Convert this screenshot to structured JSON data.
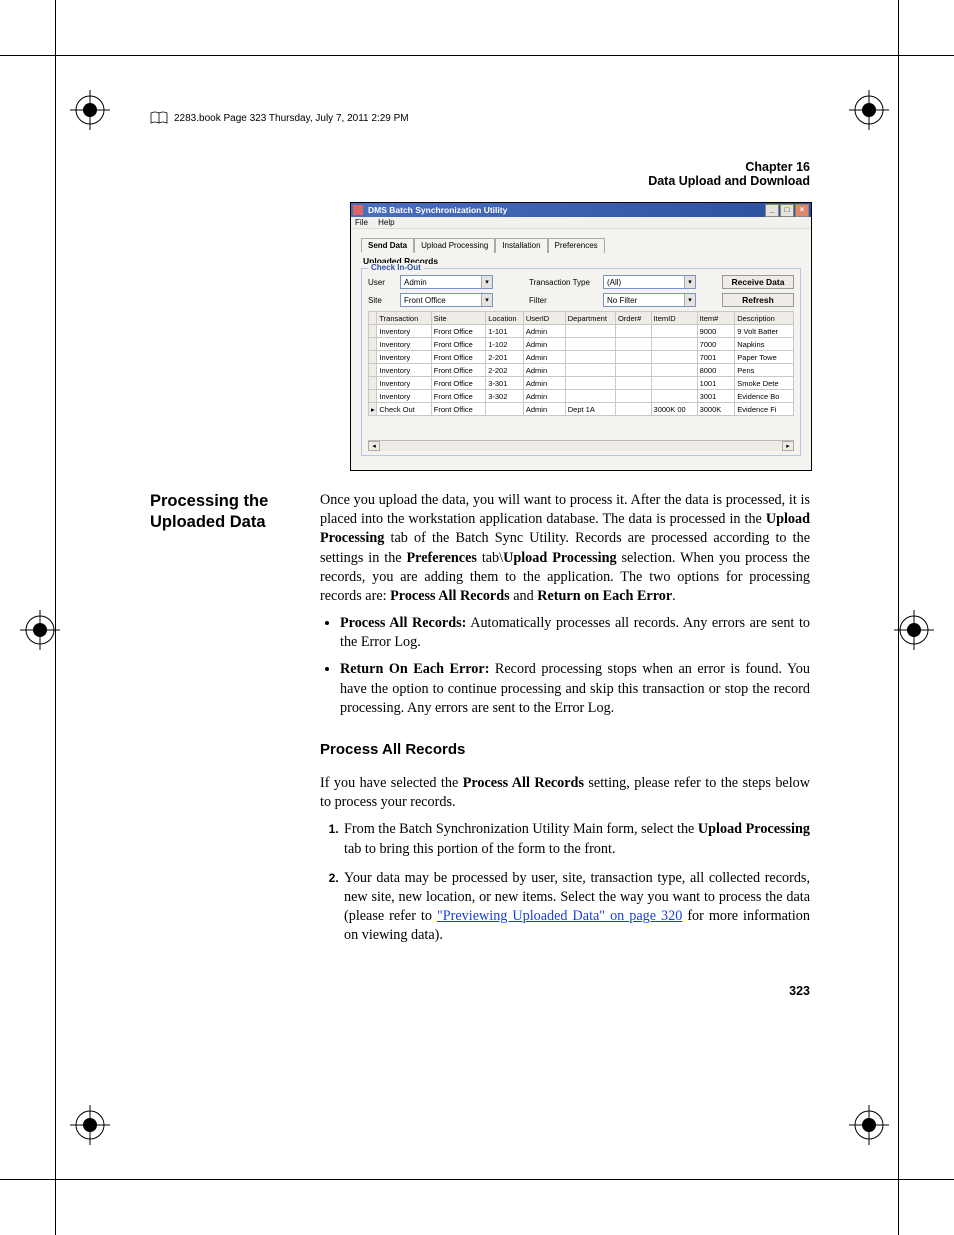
{
  "running_head": "2283.book  Page 323  Thursday, July 7, 2011  2:29 PM",
  "chapter": {
    "line1": "Chapter 16",
    "line2": "Data Upload and Download"
  },
  "page_number": "323",
  "screenshot": {
    "title": "DMS Batch Synchronization Utility",
    "menus": [
      "File",
      "Help"
    ],
    "tabs": [
      "Send Data",
      "Upload Processing",
      "Installation",
      "Preferences"
    ],
    "section_label": "Uploaded Records",
    "group_legend": "Check In-Out",
    "filters": {
      "user_label": "User",
      "user_value": "Admin",
      "site_label": "Site",
      "site_value": "Front Office",
      "txn_label": "Transaction Type",
      "txn_value": "(All)",
      "filter_label": "Filter",
      "filter_value": "No Filter"
    },
    "buttons": {
      "receive": "Receive Data",
      "refresh": "Refresh"
    },
    "columns": [
      "Transaction",
      "Site",
      "Location",
      "UserID",
      "Department",
      "Order#",
      "ItemID",
      "Item#",
      "Description"
    ],
    "rows": [
      {
        "txn": "Inventory",
        "site": "Front Office",
        "loc": "1-101",
        "user": "Admin",
        "dept": "",
        "order": "",
        "itemid": "",
        "itemno": "9000",
        "desc": "9 Volt Batter"
      },
      {
        "txn": "Inventory",
        "site": "Front Office",
        "loc": "1-102",
        "user": "Admin",
        "dept": "",
        "order": "",
        "itemid": "",
        "itemno": "7000",
        "desc": "Napkins"
      },
      {
        "txn": "Inventory",
        "site": "Front Office",
        "loc": "2-201",
        "user": "Admin",
        "dept": "",
        "order": "",
        "itemid": "",
        "itemno": "7001",
        "desc": "Paper Towe"
      },
      {
        "txn": "Inventory",
        "site": "Front Office",
        "loc": "2-202",
        "user": "Admin",
        "dept": "",
        "order": "",
        "itemid": "",
        "itemno": "8000",
        "desc": "Pens"
      },
      {
        "txn": "Inventory",
        "site": "Front Office",
        "loc": "3-301",
        "user": "Admin",
        "dept": "",
        "order": "",
        "itemid": "",
        "itemno": "1001",
        "desc": "Smoke Dete"
      },
      {
        "txn": "Inventory",
        "site": "Front Office",
        "loc": "3-302",
        "user": "Admin",
        "dept": "",
        "order": "",
        "itemid": "",
        "itemno": "3001",
        "desc": "Evidence Bo"
      },
      {
        "txn": "Check Out",
        "site": "Front Office",
        "loc": "",
        "user": "Admin",
        "dept": "Dept 1A",
        "order": "",
        "itemid": "3000K 00",
        "itemno": "3000K",
        "desc": "Evidence Fi"
      }
    ]
  },
  "side_heading": "Processing the Uploaded Data",
  "body": {
    "p1_a": "Once you upload the data, you will want to process it. After the data is processed, it is placed into the workstation application database. The data is processed in the ",
    "p1_b": "Upload Processing",
    "p1_c": " tab of the Batch Sync Utility. Records are processed according to the settings in the ",
    "p1_d": "Preferences",
    "p1_e": " tab\\",
    "p1_f": "Upload Processing",
    "p1_g": " selection. When you process the records, you are adding them to the  application. The two options for processing records are: ",
    "p1_h": "Process All Records",
    "p1_i": " and ",
    "p1_j": "Return on Each Error",
    "p1_k": ".",
    "bullet1_head": "Process All Records:",
    "bullet1_tail": " Automatically processes all records. Any errors are sent to the Error Log.",
    "bullet2_head": "Return On Each Error:",
    "bullet2_tail": " Record processing stops when an error is found. You have the option to continue processing and skip this transaction or stop the record processing. Any errors are sent to the Error Log.",
    "subhead": "Process All Records",
    "p2_a": "If you have selected the ",
    "p2_b": "Process All Records",
    "p2_c": " setting, please refer to the steps below to process your records.",
    "step1_a": "From the Batch Synchronization Utility Main form, select the ",
    "step1_b": "Upload Processing",
    "step1_c": " tab to bring this portion of the form to the front.",
    "step2_a": "Your data may be processed by user, site, transaction type, all collected records, new site, new location, or new items. Select the way you want to process the data (please refer to ",
    "step2_link": "\"Previewing Uploaded Data\" on page 320",
    "step2_b": " for more information on viewing data)."
  }
}
